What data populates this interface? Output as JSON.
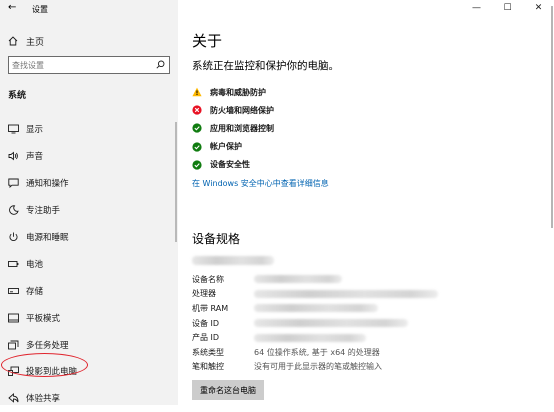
{
  "window": {
    "title": "设置",
    "controls": {
      "minimize": "—",
      "maximize": "☐",
      "close": "✕"
    }
  },
  "sidebar": {
    "back_icon": "back-arrow-icon",
    "home_label": "主页",
    "search_placeholder": "查找设置",
    "section_label": "系统",
    "items": [
      {
        "label": "显示",
        "icon": "display-icon"
      },
      {
        "label": "声音",
        "icon": "sound-icon"
      },
      {
        "label": "通知和操作",
        "icon": "notifications-icon"
      },
      {
        "label": "专注助手",
        "icon": "moon-icon"
      },
      {
        "label": "电源和睡眠",
        "icon": "power-icon"
      },
      {
        "label": "电池",
        "icon": "battery-icon"
      },
      {
        "label": "存储",
        "icon": "storage-icon"
      },
      {
        "label": "平板模式",
        "icon": "tablet-icon"
      },
      {
        "label": "多任务处理",
        "icon": "multitasking-icon"
      },
      {
        "label": "投影到此电脑",
        "icon": "projecting-icon"
      },
      {
        "label": "体验共享",
        "icon": "shared-experiences-icon"
      }
    ],
    "highlighted_item": "投影到此电脑",
    "highlight_color": "#e0242d"
  },
  "main": {
    "title": "关于",
    "subtitle": "系统正在监控和保护你的电脑。",
    "status_items": [
      {
        "label": "病毒和威胁防护",
        "status": "warning",
        "color": "#ffb900"
      },
      {
        "label": "防火墙和网络保护",
        "status": "error",
        "color": "#e81123"
      },
      {
        "label": "应用和浏览器控制",
        "status": "ok",
        "color": "#107c10"
      },
      {
        "label": "帐户保护",
        "status": "ok",
        "color": "#107c10"
      },
      {
        "label": "设备安全性",
        "status": "ok",
        "color": "#107c10"
      }
    ],
    "security_link": "在 Windows 安全中心中查看详细信息",
    "link_color": "#0063b1",
    "specs_title": "设备规格",
    "specs": [
      {
        "key": "设备名称",
        "value": ""
      },
      {
        "key": "处理器",
        "value": ""
      },
      {
        "key": "机带 RAM",
        "value": ""
      },
      {
        "key": "设备 ID",
        "value": ""
      },
      {
        "key": "产品 ID",
        "value": ""
      },
      {
        "key": "系统类型",
        "value": "64 位操作系统, 基于 x64 的处理器"
      },
      {
        "key": "笔和触控",
        "value": "没有可用于此显示器的笔或触控输入"
      }
    ],
    "rename_button": "重命名这台电脑"
  }
}
